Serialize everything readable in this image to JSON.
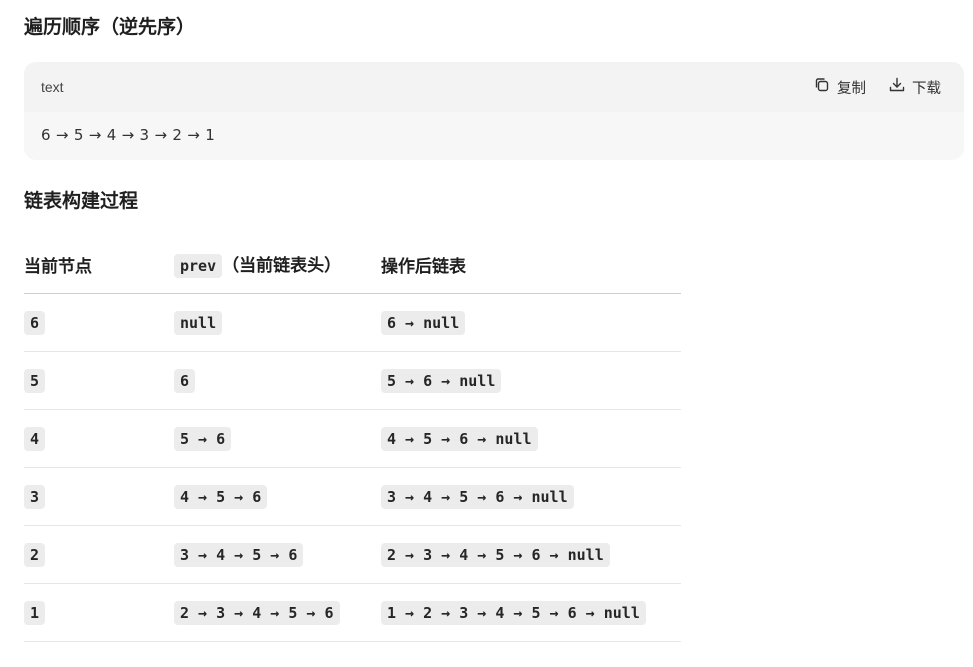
{
  "heading_traversal": "遍历顺序（逆先序）",
  "codeblock": {
    "language": "text",
    "copy_label": "复制",
    "download_label": "下载",
    "content": "6 → 5 → 4 → 3 → 2 → 1"
  },
  "heading_build": "链表构建过程",
  "table": {
    "headers": {
      "current": "当前节点",
      "prev_code": "prev",
      "prev_note": "（当前链表头）",
      "after": "操作后链表"
    },
    "rows": [
      {
        "node": "6",
        "prev": "null",
        "after": "6 → null"
      },
      {
        "node": "5",
        "prev": "6",
        "after": "5 → 6 → null"
      },
      {
        "node": "4",
        "prev": "5 → 6",
        "after": "4 → 5 → 6 → null"
      },
      {
        "node": "3",
        "prev": "4 → 5 → 6",
        "after": "3 → 4 → 5 → 6 → null"
      },
      {
        "node": "2",
        "prev": "3 → 4 → 5 → 6",
        "after": "2 → 3 → 4 → 5 → 6 → null"
      },
      {
        "node": "1",
        "prev": "2 → 3 → 4 → 5 → 6",
        "after": "1 → 2 → 3 → 4 → 5 → 6 → null"
      }
    ]
  }
}
